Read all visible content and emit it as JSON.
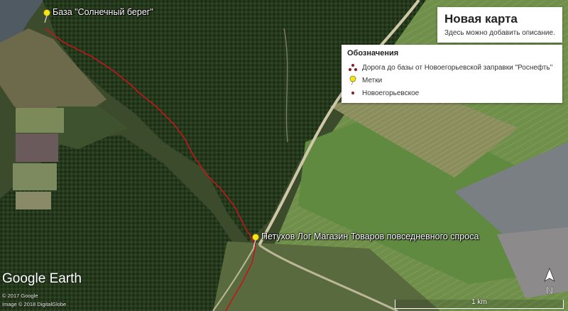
{
  "map": {
    "placemarks": [
      {
        "label": "База \"Солнечный берег\""
      },
      {
        "label": "Петухов Лог Магазин Товаров повседневного спроса"
      }
    ]
  },
  "title_card": {
    "title": "Новая карта",
    "description": "Здесь можно добавить описание."
  },
  "legend": {
    "heading": "Обозначения",
    "items": [
      {
        "label": "Дорога до базы от Новоегорьевской заправки \"Роснефть\"",
        "icon": "route-points-icon",
        "color": "#8a1a1a"
      },
      {
        "label": "Метки",
        "icon": "yellow-pushpin-icon",
        "color": "#f5e51b"
      },
      {
        "label": "Новоегорьевское",
        "icon": "dot-icon",
        "color": "#8a1a1a"
      }
    ]
  },
  "branding": {
    "logo_google": "Google",
    "logo_earth": "Earth",
    "copyright_1": "© 2017 Google",
    "copyright_2": "Image © 2018 DigitalGlobe"
  },
  "scale": {
    "label": "1 km"
  },
  "compass": {
    "label": "N"
  },
  "colors": {
    "route": "#c0161b",
    "pin": "#f5e51b",
    "forest": "#25361c",
    "field": "#6e8c49"
  }
}
